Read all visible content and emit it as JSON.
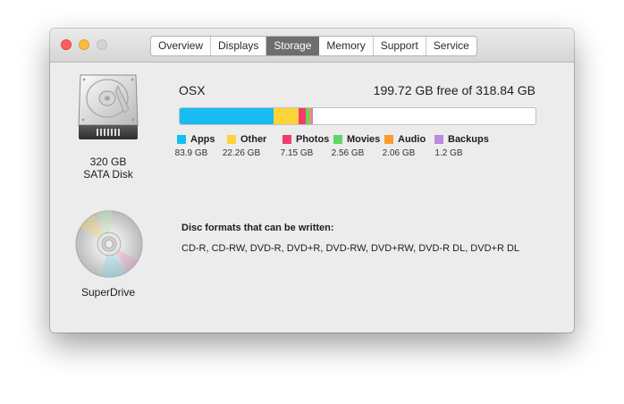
{
  "tabs": [
    "Overview",
    "Displays",
    "Storage",
    "Memory",
    "Support",
    "Service"
  ],
  "active_tab": "Storage",
  "drive": {
    "size_label": "320 GB",
    "type_label": "SATA Disk",
    "volume_name": "OSX",
    "free_text": "199.72 GB free of 318.84 GB",
    "capacity_gb": 318.84,
    "categories": [
      {
        "name": "Apps",
        "size": "83.9 GB",
        "gb": 83.9,
        "color": "#17bcf0"
      },
      {
        "name": "Other",
        "size": "22.26 GB",
        "gb": 22.26,
        "color": "#fcd439"
      },
      {
        "name": "Photos",
        "size": "7.15 GB",
        "gb": 7.15,
        "color": "#f23d6c"
      },
      {
        "name": "Movies",
        "size": "2.56 GB",
        "gb": 2.56,
        "color": "#61d662"
      },
      {
        "name": "Audio",
        "size": "2.06 GB",
        "gb": 2.06,
        "color": "#fb9b2b"
      },
      {
        "name": "Backups",
        "size": "1.2 GB",
        "gb": 1.2,
        "color": "#b98ae0"
      }
    ]
  },
  "superdrive": {
    "label": "SuperDrive",
    "formats_heading": "Disc formats that can be written:",
    "formats": "CD-R, CD-RW, DVD-R, DVD+R, DVD-RW, DVD+RW, DVD-R DL, DVD+R DL"
  },
  "icons": {
    "hard_disk": "hard-disk-icon",
    "optical_disc": "optical-disc-icon"
  }
}
